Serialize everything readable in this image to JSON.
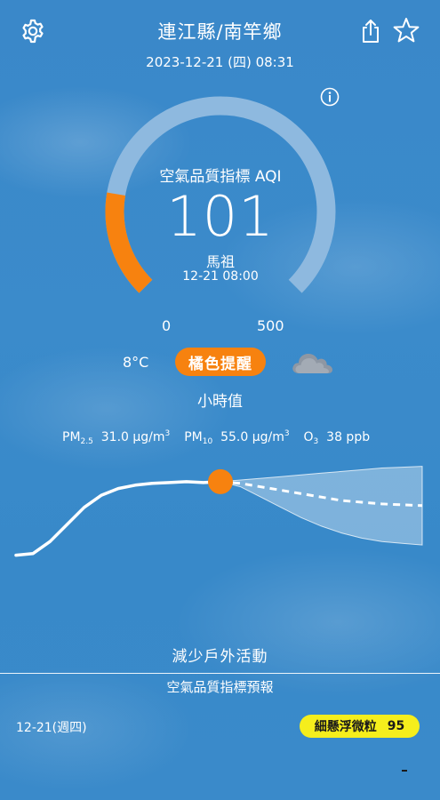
{
  "header": {
    "title": "連江縣/南竿鄉",
    "datetime": "2023-12-21 (四) 08:31"
  },
  "gauge": {
    "label": "空氣品質指標 AQI",
    "value": "101",
    "station": "馬祖",
    "station_time": "12-21 08:00",
    "min": "0",
    "max": "500",
    "fill_fraction": 0.202,
    "fill_color": "#f7820f",
    "track_color": "#8eb9df"
  },
  "status": {
    "temperature": "8°C",
    "badge": "橘色提醒",
    "badge_color": "#f7820f",
    "weather_icon": "cloud-icon",
    "hourly_label": "小時值"
  },
  "pollutants": {
    "pm25_name": "PM",
    "pm25_sub": "2.5",
    "pm25_value": "31.0 μg/m",
    "pm25_sup": "3",
    "pm10_name": "PM",
    "pm10_sub": "10",
    "pm10_value": "55.0 μg/m",
    "pm10_sup": "3",
    "o3_name": "O",
    "o3_sub": "3",
    "o3_value": "38 ppb"
  },
  "trend": {
    "history": [
      58,
      59,
      66,
      76,
      86,
      93,
      97,
      99,
      100,
      100.5,
      101,
      100.5,
      101
    ],
    "forecast": [
      101,
      100,
      98,
      96,
      94,
      92,
      90,
      89,
      88,
      87.5,
      87
    ],
    "band_upper": [
      101,
      102,
      103,
      104,
      105,
      106,
      107,
      108,
      109,
      109.5,
      110
    ],
    "band_lower": [
      101,
      98,
      92,
      86,
      80,
      75,
      71,
      68,
      66,
      65,
      64
    ],
    "current_color": "#f7820f"
  },
  "advice": "減少戶外活動",
  "forecast": {
    "title": "空氣品質指標預報",
    "date": "12-21(週四)",
    "pollutant": "細懸浮微粒",
    "value": "95",
    "badge_color": "#f5ee1c"
  }
}
